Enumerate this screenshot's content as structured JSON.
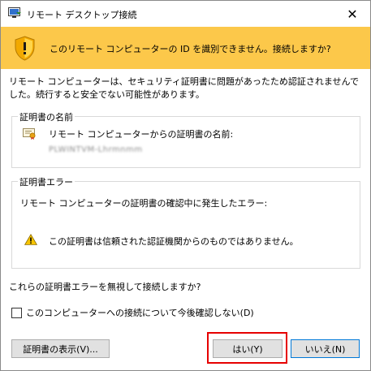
{
  "window": {
    "title": "リモート デスクトップ接続",
    "close_symbol": "✕"
  },
  "banner": {
    "message": "このリモート コンピューターの ID を識別できません。接続しますか?",
    "color": "#fcc84a"
  },
  "description": "リモート コンピューターは、セキュリティ証明書に問題があったため認証されませんでした。続行すると安全でない可能性があります。",
  "cert_name_group": {
    "title": "証明書の名前",
    "label": "リモート コンピューターからの証明書の名前:",
    "value": "PLWINTVM-Lhrmnmm"
  },
  "cert_error_group": {
    "title": "証明書エラー",
    "label": "リモート コンピューターの証明書の確認中に発生したエラー:",
    "error": "この証明書は信頼された認証機関からのものではありません。"
  },
  "question": "これらの証明書エラーを無視して接続しますか?",
  "checkbox": {
    "label": "このコンピューターへの接続について今後確認しない(D)",
    "checked": false
  },
  "buttons": {
    "view_cert": "証明書の表示(V)...",
    "yes": "はい(Y)",
    "no": "いいえ(N)"
  },
  "icons": {
    "title": "remote-desktop-icon",
    "banner": "shield-warning-icon",
    "cert": "certificate-icon",
    "warn": "warning-icon"
  },
  "colors": {
    "highlight": "#e60000",
    "focus": "#0078d7"
  }
}
